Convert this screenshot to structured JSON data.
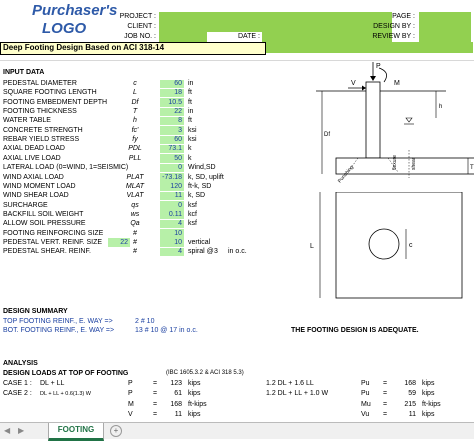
{
  "header": {
    "logo_line1": "Purchaser's",
    "logo_line2": "LOGO",
    "project_label": "PROJECT :",
    "client_label": "CLIENT :",
    "jobno_label": "JOB NO. :",
    "date_label": "DATE :",
    "page_label": "PAGE :",
    "designby_label": "DESIGN BY :",
    "reviewby_label": "REVIEW BY :"
  },
  "title": "Deep Footing Design Based on ACI 318-14",
  "input": {
    "heading": "INPUT DATA",
    "rows": [
      {
        "label": "PEDESTAL DIAMETER",
        "sym": "c",
        "value": "60",
        "unit": "in"
      },
      {
        "label": "SQUARE FOOTING LENGTH",
        "sym": "L",
        "value": "18",
        "unit": "ft"
      },
      {
        "label": "FOOTING EMBEDMENT DEPTH",
        "sym": "Df",
        "value": "10.5",
        "unit": "ft"
      },
      {
        "label": "FOOTING THICKNESS",
        "sym": "T",
        "value": "22",
        "unit": "in"
      },
      {
        "label": "WATER TABLE",
        "sym": "h",
        "value": "8",
        "unit": "ft"
      },
      {
        "label": "CONCRETE STRENGTH",
        "sym": "fc'",
        "value": "3",
        "unit": "ksi"
      },
      {
        "label": "REBAR YIELD STRESS",
        "sym": "fy",
        "value": "60",
        "unit": "ksi"
      },
      {
        "label": "AXIAL DEAD LOAD",
        "sym": "PDL",
        "value": "73.1",
        "unit": "k"
      },
      {
        "label": "AXIAL LIVE LOAD",
        "sym": "PLL",
        "value": "50",
        "unit": "k"
      },
      {
        "label": "LATERAL LOAD (0=WIND, 1=SEISMIC)",
        "sym": "",
        "value": "0",
        "unit": "Wind,SD"
      },
      {
        "label": "WIND AXIAL LOAD",
        "sym": "PLAT",
        "value": "-73.18",
        "unit": "k, SD, uplift"
      },
      {
        "label": "WIND MOMENT LOAD",
        "sym": "MLAT",
        "value": "120",
        "unit": "ft-k, SD"
      },
      {
        "label": "WIND SHEAR LOAD",
        "sym": "VLAT",
        "value": "11",
        "unit": "k, SD"
      },
      {
        "label": "SURCHARGE",
        "sym": "qs",
        "value": "0",
        "unit": "ksf"
      },
      {
        "label": "BACKFILL SOIL WEIGHT",
        "sym": "ws",
        "value": "0.11",
        "unit": "kcf"
      },
      {
        "label": "ALLOW SOIL PRESSURE",
        "sym": "Qa",
        "value": "4",
        "unit": "ksf"
      },
      {
        "label": "FOOTING REINFORCING SIZE",
        "sym": "#",
        "value": "10",
        "unit": ""
      },
      {
        "label": "PEDESTAL VERT. REINF. SIZE",
        "sym": "#",
        "value": "10",
        "unit": "vertical",
        "pre": "22"
      },
      {
        "label": "PEDESTAL SHEAR. REINF.",
        "sym": "#",
        "value": "4",
        "unit": "in o.c.",
        "spiral": "spiral @",
        "spacing": "3"
      }
    ]
  },
  "summary": {
    "heading": "DESIGN SUMMARY",
    "top_label": "TOP FOOTING REINF., E. WAY =>",
    "top_value": "2 # 10",
    "bot_label": "BOT. FOOTING REINF., E. WAY =>",
    "bot_value": "13 # 10 @ 17 in o.c.",
    "status": "THE FOOTING DESIGN IS ADEQUATE."
  },
  "analysis": {
    "heading": "ANALYSIS",
    "design_loads": "DESIGN  LOADS AT TOP OF FOOTING",
    "code_ref": "(IBC 1605.3.2 & ACI 318 5.3)",
    "case1_label": "CASE 1 :",
    "case1_combo": "DL + LL",
    "case1_p_sym": "P",
    "case1_p_val": "123",
    "case1_p_unit": "kips",
    "case1_right_combo": "1.2 DL + 1.6 LL",
    "case1_pu_sym": "Pu",
    "case1_pu_val": "168",
    "case1_pu_unit": "kips",
    "case2_label": "CASE 2 :",
    "case2_combo": "DL + LL + 0.6(1.3) W",
    "case2_p_sym": "P",
    "case2_p_val": "61",
    "case2_p_unit": "kips",
    "case2_right_combo": "1.2 DL + LL + 1.0 W",
    "case2_pu_sym": "Pu",
    "case2_pu_val": "59",
    "case2_pu_unit": "kips",
    "m_sym": "M",
    "m_val": "168",
    "m_unit": "ft-kips",
    "mu_sym": "Mu",
    "mu_val": "215",
    "mu_unit": "ft-kips",
    "v_sym": "V",
    "v_val": "11",
    "v_unit": "kips",
    "vu_sym": "Vu",
    "vu_val": "11",
    "vu_unit": "kips"
  },
  "diagram": {
    "p": "P",
    "m": "M",
    "v": "V",
    "df": "Df",
    "t": "T",
    "h": "h",
    "flexure": "flexure",
    "shear": "shear",
    "punching": "Punching",
    "l": "L",
    "c": "c"
  },
  "tabs": {
    "active": "FOOTING",
    "add": "+"
  }
}
